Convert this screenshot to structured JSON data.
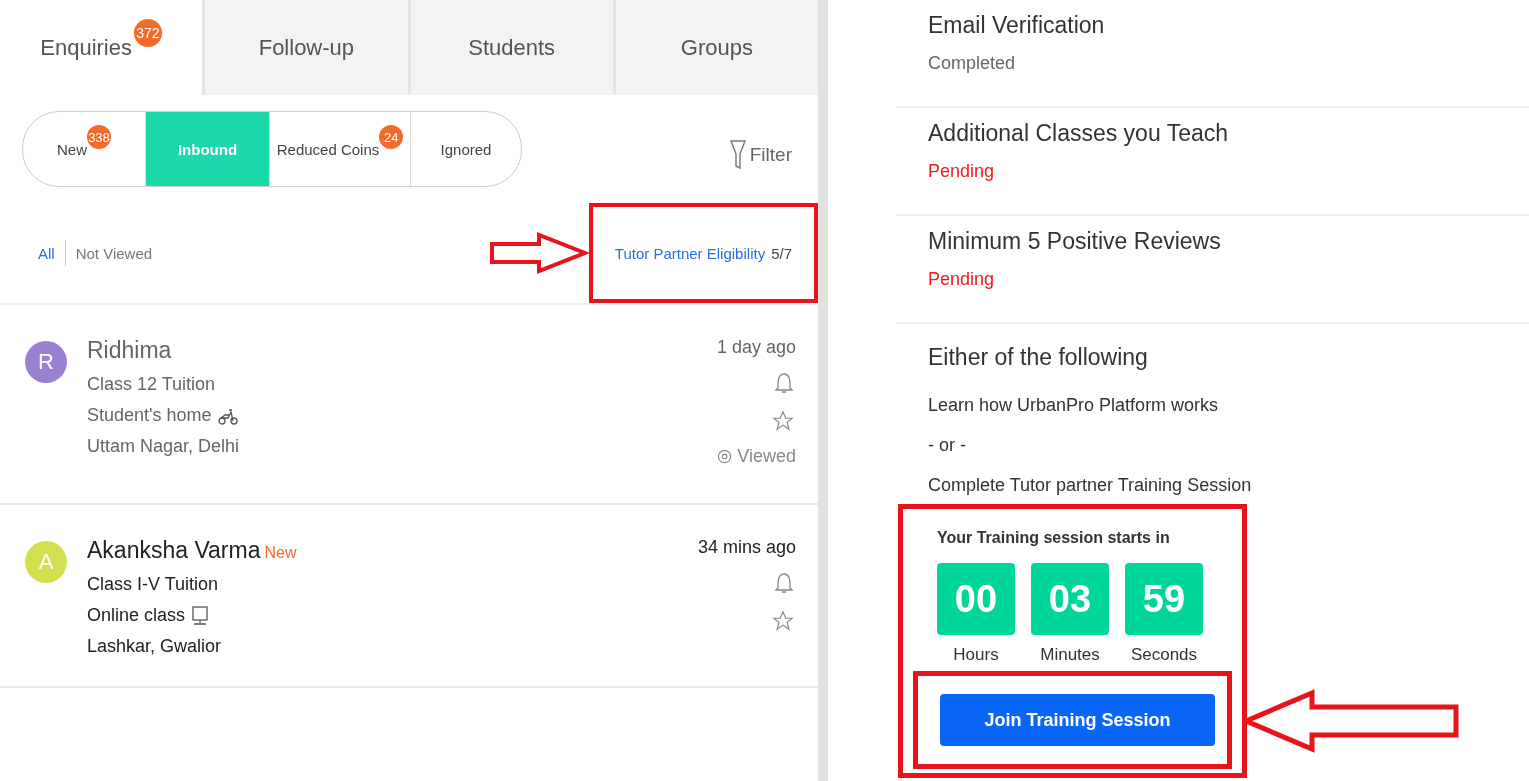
{
  "tabs": [
    {
      "label": "Enquiries",
      "badge": "372",
      "selected": true
    },
    {
      "label": "Follow-up",
      "selected": false
    },
    {
      "label": "Students",
      "selected": false
    },
    {
      "label": "Groups",
      "selected": false
    }
  ],
  "segments": [
    {
      "label": "New",
      "badge": "338",
      "selected": false
    },
    {
      "label": "Inbound",
      "selected": true
    },
    {
      "label": "Reduced Coins",
      "badge": "24",
      "selected": false
    },
    {
      "label": "Ignored",
      "selected": false
    }
  ],
  "filter": {
    "label": "Filter"
  },
  "view_filters": [
    {
      "label": "All",
      "selected": true
    },
    {
      "label": "Not Viewed",
      "selected": false
    }
  ],
  "eligibility": {
    "label": "Tutor Partner Eligibility",
    "count": "5/7",
    "highlighted": true
  },
  "enquiries": [
    {
      "initial": "R",
      "color": "#9b7fd0",
      "name": "Ridhima",
      "time": "1 day ago",
      "subject": "Class 12 Tuition",
      "kind": "home",
      "mode_text": "Student's home",
      "location": "Uttam Nagar, Delhi",
      "viewed": true,
      "viewed_label": "Viewed"
    },
    {
      "initial": "A",
      "color": "#d2e04f",
      "name": "Akanksha Varma",
      "tag": "New",
      "time": "34 mins ago",
      "subject": "Class I-V Tuition",
      "kind": "online",
      "mode_text": "Online class",
      "location": "Lashkar, Gwalior",
      "viewed": false
    }
  ],
  "requirements": [
    {
      "title": "Email Verification",
      "status": "Completed",
      "kind": "completed"
    },
    {
      "title": "Additional Classes you Teach",
      "status": "Pending",
      "kind": "pending"
    },
    {
      "title": "Minimum 5 Positive Reviews",
      "status": "Pending",
      "kind": "pending"
    }
  ],
  "either": {
    "title": "Either of the following",
    "options": [
      "Learn how UrbanPro Platform works",
      "- or -",
      "Complete Tutor partner Training Session"
    ]
  },
  "timer": {
    "title": "Your Training session starts in",
    "highlighted": true,
    "units": [
      {
        "value": "00",
        "label": "Hours"
      },
      {
        "value": "03",
        "label": "Minutes"
      },
      {
        "value": "59",
        "label": "Seconds"
      }
    ]
  },
  "join_button": {
    "label": "Join Training Session",
    "highlighted": true
  }
}
